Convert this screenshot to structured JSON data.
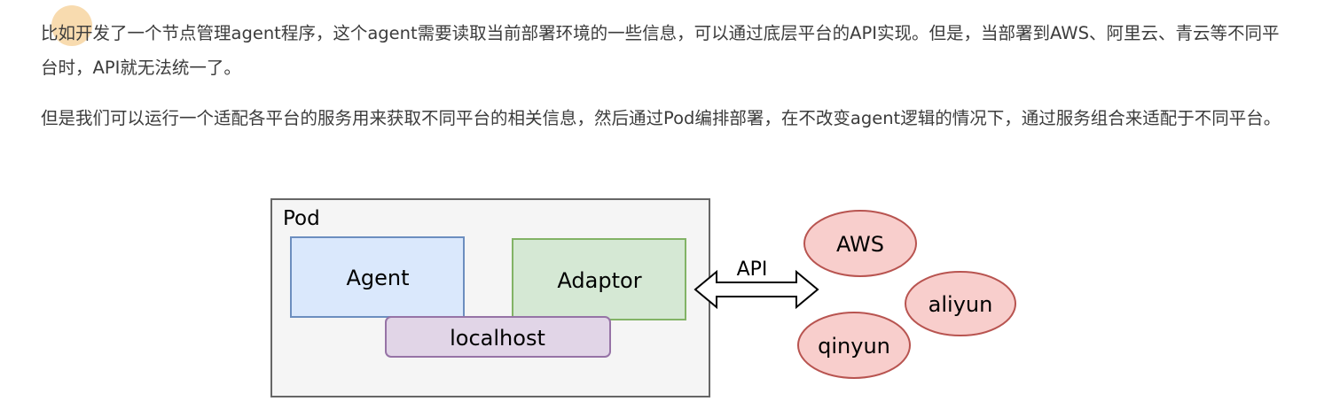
{
  "article": {
    "paragraph_1": "比如开发了一个节点管理agent程序，这个agent需要读取当前部署环境的一些信息，可以通过底层平台的API实现。但是，当部署到AWS、阿里云、青云等不同平台时，API就无法统一了。",
    "paragraph_2": "但是我们可以运行一个适配各平台的服务用来获取不同平台的相关信息，然后通过Pod编排部署，在不改变agent逻辑的情况下，通过服务组合来适配于不同平台。"
  },
  "diagram": {
    "pod_label": "Pod",
    "agent_label": "Agent",
    "adaptor_label": "Adaptor",
    "localhost_label": "localhost",
    "api_label": "API",
    "platforms": [
      "AWS",
      "aliyun",
      "qinyun"
    ],
    "colors": {
      "pod_fill": "#f5f5f5",
      "agent_fill": "#dae8fc",
      "agent_stroke": "#6c8ebf",
      "adaptor_fill": "#d5e8d4",
      "adaptor_stroke": "#82b366",
      "localhost_fill": "#e1d5e7",
      "localhost_stroke": "#9673a6",
      "platform_fill": "#f8cecc",
      "platform_stroke": "#b85450"
    }
  }
}
